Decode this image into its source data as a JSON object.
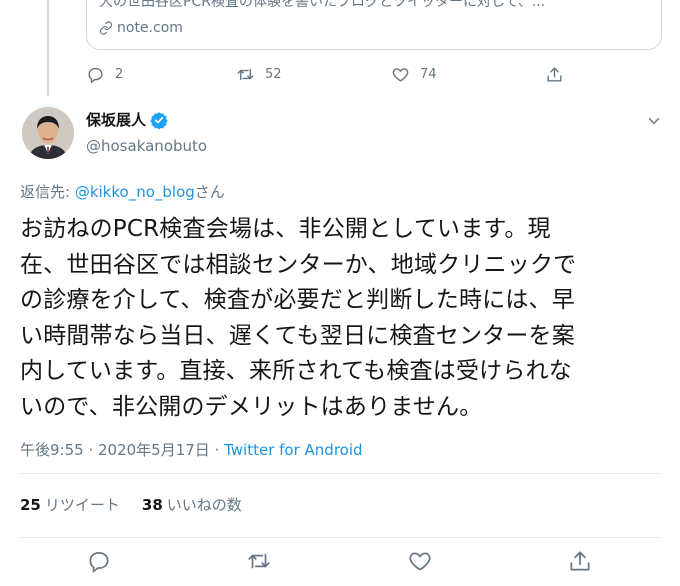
{
  "colors": {
    "accent": "#1b95e0",
    "muted_text": "#657786",
    "text": "#14171a",
    "border": "#ccd6dd",
    "verified": "#1da1f2"
  },
  "previous_tweet": {
    "card": {
      "description": "大の世田谷区PCR検査の体験を書いたブログとツイッターに対して、...",
      "domain": "note.com",
      "domain_icon": "link-icon"
    },
    "actions": {
      "replies": "2",
      "retweets": "52",
      "likes": "74"
    }
  },
  "tweet": {
    "author": {
      "name": "保坂展人",
      "handle": "@hosakanobuto",
      "verified": true
    },
    "reply_to": {
      "prefix": "返信先: ",
      "mention": "@kikko_no_blog",
      "suffix": "さん"
    },
    "text_lines": [
      "お訪ねのPCR検査会場は、非公開としています。現",
      "在、世田谷区では相談センターか、地域クリニックで",
      "の診療を介して、検査が必要だと判断した時には、早",
      "い時間帯なら当日、遅くても翌日に検査センターを案",
      "内しています。直接、来所されても検査は受けられな",
      "いので、非公開のデメリットはありません。"
    ],
    "timestamp": "午後9:55 · 2020年5月17日 · ",
    "source": "Twitter for Android",
    "stats": {
      "retweets_count": "25",
      "retweets_label": "リツイート",
      "likes_count": "38",
      "likes_label": "いいねの数"
    }
  }
}
